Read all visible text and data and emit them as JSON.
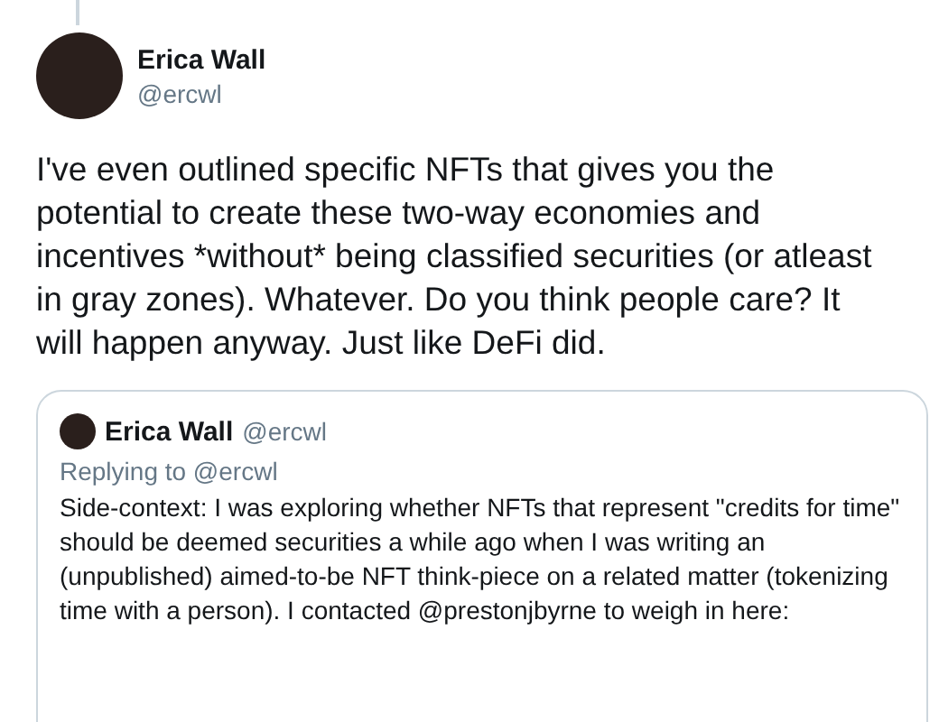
{
  "tweet": {
    "author": {
      "name": "Erica Wall",
      "handle": "@ercwl"
    },
    "text": "I've even outlined specific NFTs that gives you the potential to create these two-way economies and incentives *without* being classified securities (or atleast in gray zones). Whatever. Do you think people care? It will happen anyway. Just like DeFi did.",
    "quoted_tweet": {
      "author": {
        "name": "Erica Wall",
        "handle": "@ercwl"
      },
      "replying_to": "Replying to @ercwl",
      "text": "Side-context: I was exploring whether NFTs that represent \"credits for time\" should be deemed securities a while ago when I was writing an (unpublished) aimed-to-be NFT think-piece on a related matter (tokenizing time with a person). I contacted @prestonjbyrne to weigh in here:"
    }
  }
}
